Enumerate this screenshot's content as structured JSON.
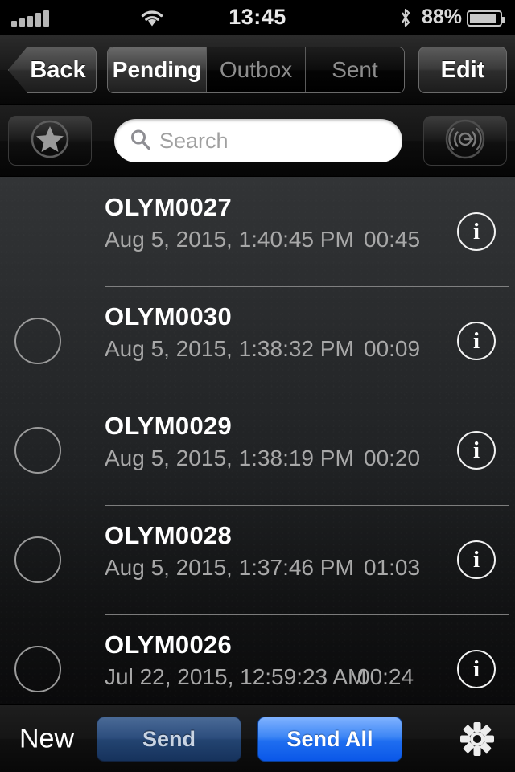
{
  "statusbar": {
    "signal_icon": "signal-bars-icon",
    "wifi_icon": "wifi-icon",
    "time": "13:45",
    "bluetooth_icon": "bluetooth-icon",
    "battery_percent": "88%",
    "battery_icon": "battery-icon",
    "battery_level": 88
  },
  "navbar": {
    "back_label": "Back",
    "edit_label": "Edit",
    "segments": [
      {
        "label": "Pending",
        "selected": true
      },
      {
        "label": "Outbox",
        "selected": false
      },
      {
        "label": "Sent",
        "selected": false
      }
    ]
  },
  "toolbar": {
    "favorites_icon": "star-circle-icon",
    "broadcast_icon": "broadcast-circle-icon",
    "search": {
      "icon": "search-icon",
      "value": "",
      "placeholder": "Search"
    }
  },
  "list": {
    "info_glyph": "i",
    "rows": [
      {
        "title": "OLYM0027",
        "date": "Aug 5, 2015, 1:40:45 PM",
        "duration": "00:45",
        "has_selector": false,
        "selected": false
      },
      {
        "title": "OLYM0030",
        "date": "Aug 5, 2015, 1:38:32 PM",
        "duration": "00:09",
        "has_selector": true,
        "selected": false
      },
      {
        "title": "OLYM0029",
        "date": "Aug 5, 2015, 1:38:19 PM",
        "duration": "00:20",
        "has_selector": true,
        "selected": false
      },
      {
        "title": "OLYM0028",
        "date": "Aug 5, 2015, 1:37:46 PM",
        "duration": "01:03",
        "has_selector": true,
        "selected": false
      },
      {
        "title": "OLYM0026",
        "date": "Jul 22, 2015, 12:59:23 AM",
        "duration": "00:24",
        "has_selector": true,
        "selected": false
      }
    ]
  },
  "bottombar": {
    "new_label": "New",
    "send_label": "Send",
    "send_all_label": "Send All",
    "settings_icon": "gear-icon"
  },
  "colors": {
    "send_all_blue": "#1f6ef0",
    "send_blue": "#234471",
    "list_text": "#ffffff",
    "list_subtext": "#a8a8a8"
  }
}
